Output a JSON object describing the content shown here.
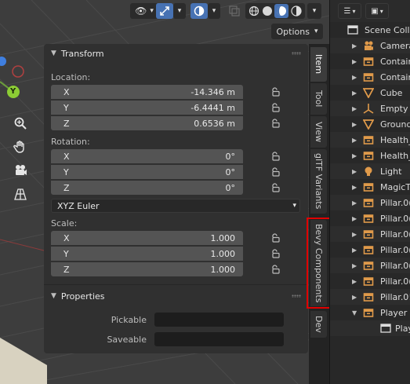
{
  "viewport": {
    "header": {
      "view_icon": "eye-icon",
      "gizmo_icon": "transform-gizmo-icon",
      "overlay_icon": "overlay-icon",
      "xray_icon": "xray-icon",
      "shading_icons": [
        "wireframe-shading-icon",
        "solid-shading-icon",
        "material-shading-icon",
        "rendered-shading-icon"
      ]
    },
    "options_label": "Options",
    "gizmo_axis_label": "Y",
    "nav_tools": [
      "zoom-icon",
      "hand-pan-icon",
      "camera-icon",
      "ortho-grid-icon"
    ]
  },
  "transform": {
    "title": "Transform",
    "location_label": "Location:",
    "location": [
      {
        "axis": "X",
        "value": "-14.346 m"
      },
      {
        "axis": "Y",
        "value": "-6.4441 m"
      },
      {
        "axis": "Z",
        "value": "0.6536 m"
      }
    ],
    "rotation_label": "Rotation:",
    "rotation": [
      {
        "axis": "X",
        "value": "0°"
      },
      {
        "axis": "Y",
        "value": "0°"
      },
      {
        "axis": "Z",
        "value": "0°"
      }
    ],
    "rotation_mode": "XYZ Euler",
    "scale_label": "Scale:",
    "scale": [
      {
        "axis": "X",
        "value": "1.000"
      },
      {
        "axis": "Y",
        "value": "1.000"
      },
      {
        "axis": "Z",
        "value": "1.000"
      }
    ]
  },
  "properties": {
    "title": "Properties",
    "pickable_label": "Pickable",
    "saveable_label": "Saveable"
  },
  "tabs": [
    "Item",
    "Tool",
    "View",
    "glTF Variants",
    "Bevy Components",
    "Dev"
  ],
  "outliner": {
    "rows": [
      {
        "text": "Scene Colle",
        "icon": "scene-collection-icon"
      },
      {
        "text": "Camera",
        "icon": "camera-object-icon"
      },
      {
        "text": "Contain",
        "icon": "empty-object-icon"
      },
      {
        "text": "Contain",
        "icon": "empty-object-icon"
      },
      {
        "text": "Cube",
        "icon": "mesh-object-icon"
      },
      {
        "text": "Empty",
        "icon": "empty-axes-icon"
      },
      {
        "text": "Ground",
        "icon": "mesh-object-icon"
      },
      {
        "text": "Health_",
        "icon": "empty-object-icon"
      },
      {
        "text": "Health_",
        "icon": "empty-object-icon"
      },
      {
        "text": "Light",
        "icon": "light-object-icon"
      },
      {
        "text": "MagicT",
        "icon": "empty-object-icon"
      },
      {
        "text": "Pillar.0(",
        "icon": "empty-object-icon"
      },
      {
        "text": "Pillar.0(",
        "icon": "empty-object-icon"
      },
      {
        "text": "Pillar.0(",
        "icon": "empty-object-icon"
      },
      {
        "text": "Pillar.0(",
        "icon": "empty-object-icon"
      },
      {
        "text": "Pillar.0(",
        "icon": "empty-object-icon"
      },
      {
        "text": "Pillar.0(",
        "icon": "empty-object-icon"
      },
      {
        "text": "Pillar.0!",
        "icon": "empty-object-icon"
      },
      {
        "text": "Player",
        "icon": "empty-object-icon"
      },
      {
        "text": "Play",
        "icon": "collection-icon"
      }
    ]
  },
  "colors": {
    "highlight": "#e00000",
    "active_blue": "#4772b3",
    "object_orange": "#e09a4a"
  }
}
